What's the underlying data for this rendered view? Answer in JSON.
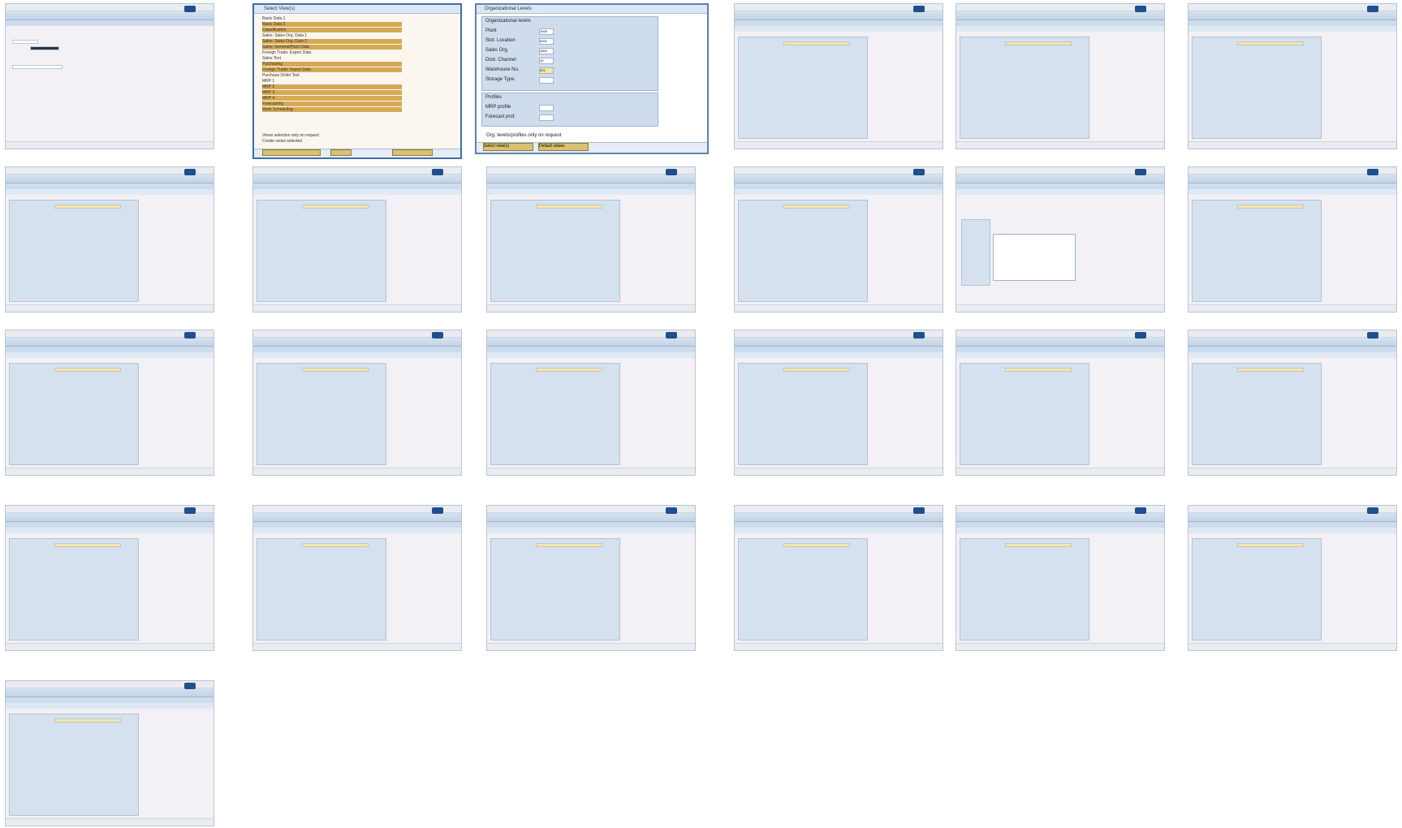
{
  "screens": [
    {
      "id": "s1"
    },
    {
      "id": "s2-views"
    },
    {
      "id": "s3-org"
    },
    {
      "id": "s4"
    },
    {
      "id": "s5"
    },
    {
      "id": "s6"
    },
    {
      "id": "s7"
    },
    {
      "id": "s8"
    },
    {
      "id": "s9"
    },
    {
      "id": "s10"
    },
    {
      "id": "s11"
    },
    {
      "id": "s12"
    },
    {
      "id": "s13"
    },
    {
      "id": "s14"
    },
    {
      "id": "s15"
    },
    {
      "id": "s16"
    },
    {
      "id": "s17"
    },
    {
      "id": "s18"
    },
    {
      "id": "s19"
    },
    {
      "id": "s20"
    },
    {
      "id": "s21"
    },
    {
      "id": "s22"
    },
    {
      "id": "s23"
    },
    {
      "id": "s24"
    },
    {
      "id": "s25"
    }
  ],
  "select_views": {
    "title": "Select View(s)",
    "items": [
      "Basic Data 1",
      "Basic Data 2",
      "Classification",
      "Sales: Sales Org. Data 1",
      "Sales: Sales Org. Data 2",
      "Sales: General/Plant Data",
      "Foreign Trade: Export Data",
      "Sales Text",
      "Purchasing",
      "Foreign Trade: Import Data",
      "Purchase Order Text",
      "MRP 1",
      "MRP 2",
      "MRP 3",
      "MRP 4",
      "Forecasting",
      "Work Scheduling"
    ],
    "checkbox1": "Views selection only on request",
    "checkbox2": "Create views selected",
    "buttons": [
      "Org. levels",
      "Data",
      "Default values"
    ]
  },
  "org_levels": {
    "title": "Organizational Levels",
    "group1_title": "Organizational levels",
    "rows": [
      {
        "label": "Plant",
        "value": "1000"
      },
      {
        "label": "Stor. Location",
        "value": "0001"
      },
      {
        "label": "Sales Org.",
        "value": "1000"
      },
      {
        "label": "Distr. Channel",
        "value": "10"
      },
      {
        "label": "Warehouse No.",
        "value": "001"
      },
      {
        "label": "Storage Type",
        "value": ""
      }
    ],
    "group2_title": "Profiles",
    "profile_rows": [
      {
        "label": "MRP profile",
        "value": ""
      },
      {
        "label": "Forecast prof.",
        "value": ""
      }
    ],
    "checkbox": "Org. levels/profiles only on request",
    "buttons": [
      "Select view(s)",
      "Default values"
    ]
  }
}
